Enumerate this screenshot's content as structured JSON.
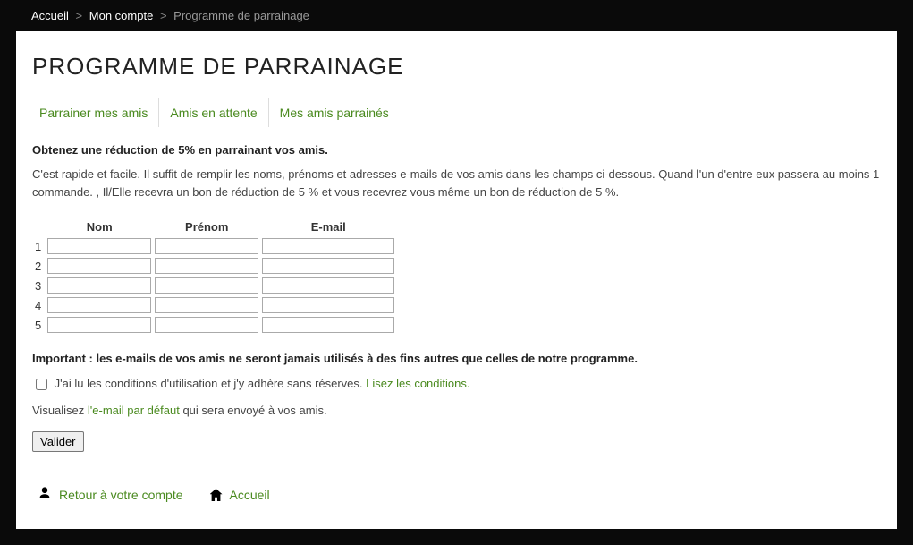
{
  "breadcrumb": {
    "home": "Accueil",
    "account": "Mon compte",
    "current": "Programme de parrainage"
  },
  "title": "PROGRAMME DE PARRAINAGE",
  "tabs": [
    {
      "label": "Parrainer mes amis"
    },
    {
      "label": "Amis en attente"
    },
    {
      "label": "Mes amis parrainés"
    }
  ],
  "lead": "Obtenez une réduction de 5% en parrainant vos amis.",
  "desc": "C'est rapide et facile. Il suffit de remplir les noms, prénoms et adresses e-mails de vos amis dans les champs ci-dessous. Quand l'un d'entre eux passera au moins 1 commande. , Il/Elle recevra un bon de réduction de 5 % et vous recevrez vous même un bon de réduction de 5 %.",
  "table": {
    "headers": {
      "name": "Nom",
      "firstname": "Prénom",
      "email": "E-mail"
    },
    "rows": [
      "1",
      "2",
      "3",
      "4",
      "5"
    ]
  },
  "important": "Important : les e-mails de vos amis ne seront jamais utilisés à des fins autres que celles de notre programme.",
  "conditions": {
    "text": "J'ai lu les conditions d'utilisation et j'y adhère sans réserves. ",
    "link": "Lisez les conditions."
  },
  "preview": {
    "before": "Visualisez ",
    "link": "l'e-mail par défaut",
    "after": " qui sera envoyé à vos amis."
  },
  "submit": "Valider",
  "footer": {
    "back": "Retour à votre compte",
    "home": "Accueil"
  }
}
